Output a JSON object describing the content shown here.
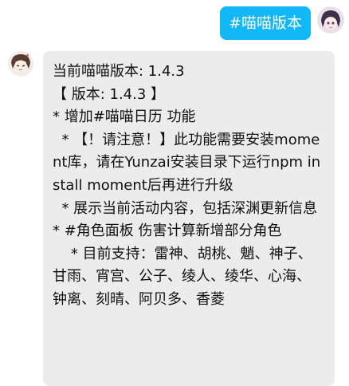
{
  "outgoing": {
    "text": "#喵喵版本"
  },
  "incoming": {
    "lines": [
      "当前喵喵版本: 1.4.3",
      "【 版本: 1.4.3 】",
      "* 增加#喵喵日历 功能",
      "  * 【！请注意！】此功能需要安装moment库，请在Yunzai安装目录下运行npm install moment后再进行升级",
      "  * 展示当前活动内容，包括深渊更新信息",
      "* #角色面板 伤害计算新增部分角色",
      "    * 目前支持：雷神、胡桃、魈、神子、甘雨、宵宫、公子、绫人、绫华、心海、钟离、刻晴、阿贝多、香菱"
    ]
  },
  "avatars": {
    "self_icon": "anime-girl-avatar",
    "bot_icon": "anime-character-avatar"
  },
  "colors": {
    "outgoing_bubble": "#12b7f5",
    "incoming_bubble": "#ececec",
    "text": "#111111"
  }
}
